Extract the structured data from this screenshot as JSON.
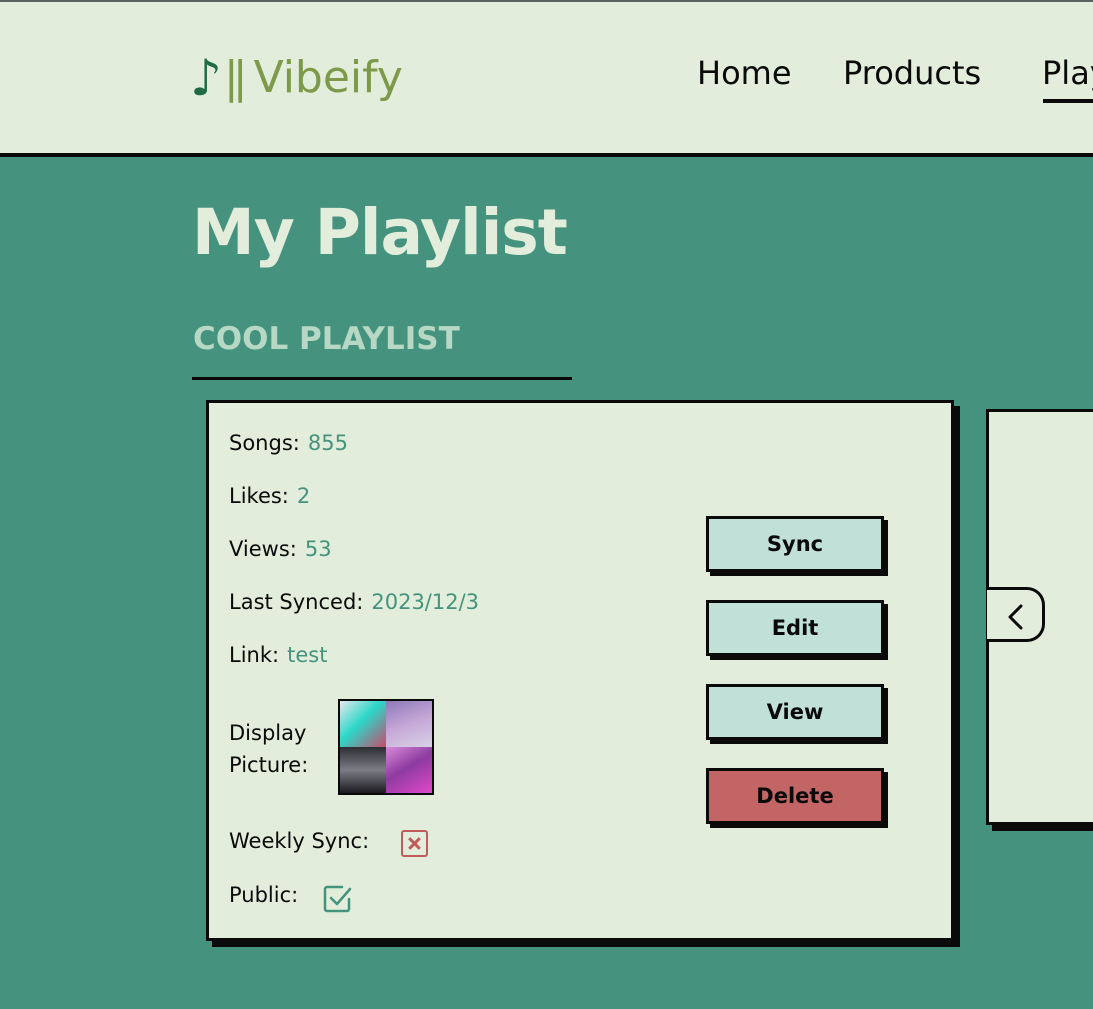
{
  "header": {
    "logo_note": "♪",
    "logo_bars": "||",
    "logo_text": "Vibeify",
    "nav": [
      "Home",
      "Products",
      "Playlists"
    ]
  },
  "main": {
    "title": "My Playlist",
    "section_heading": "COOL PLAYLIST"
  },
  "card": {
    "songs_label": "Songs:",
    "songs_value": "855",
    "likes_label": "Likes:",
    "likes_value": "2",
    "views_label": "Views:",
    "views_value": "53",
    "synced_label": "Last Synced:",
    "synced_value": "2023/12/3",
    "link_label": "Link:",
    "link_value": "test",
    "display_picture_label": "Display Picture:",
    "weekly_sync_label": "Weekly Sync:",
    "weekly_sync": false,
    "public_label": "Public:",
    "public": true,
    "buttons": {
      "sync": "Sync",
      "edit": "Edit",
      "view": "View",
      "delete": "Delete"
    }
  },
  "colors": {
    "background": "#45937e",
    "panel": "#e2eedb",
    "accent_value": "#45937e",
    "button": "#c0e0d8",
    "delete_button": "#c46565",
    "logo": "#7d9a4a",
    "unchecked": "#c35b5b"
  }
}
